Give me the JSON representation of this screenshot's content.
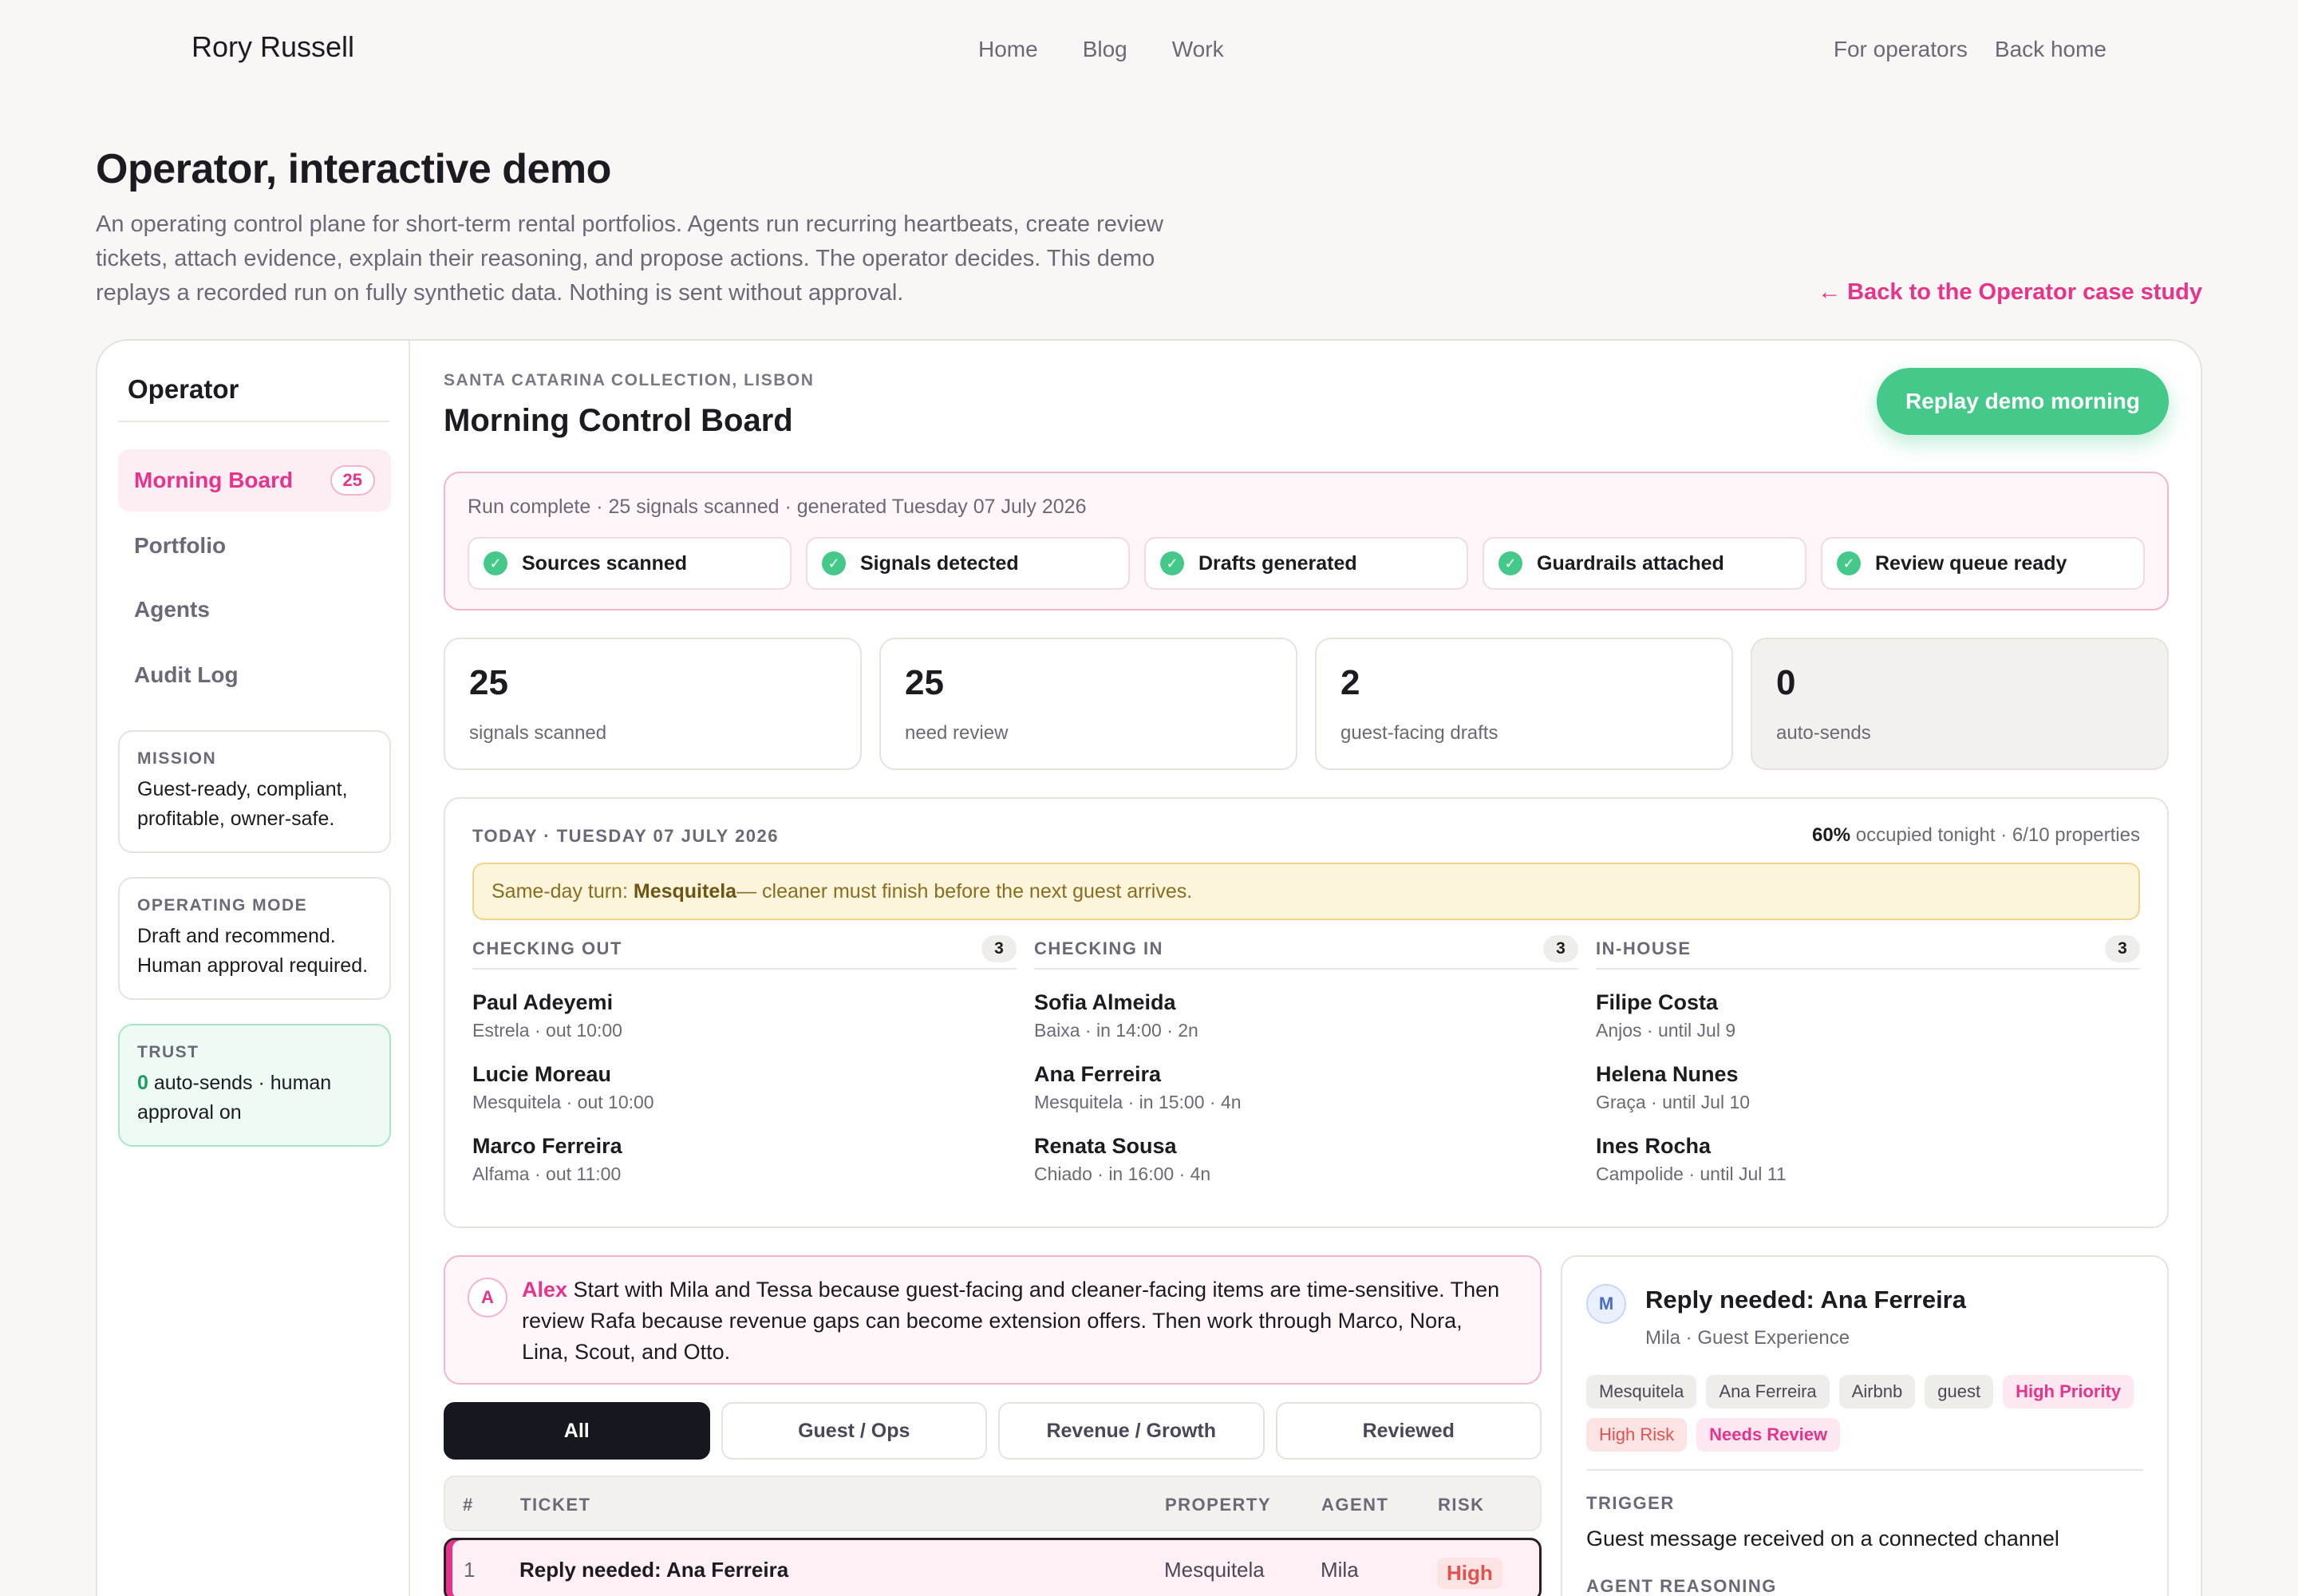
{
  "nav": {
    "brand": "Rory Russell",
    "links": [
      "Home",
      "Blog",
      "Work"
    ],
    "right_links": [
      "For operators",
      "Back home"
    ]
  },
  "hero": {
    "title": "Operator, interactive demo",
    "description": "An operating control plane for short-term rental portfolios. Agents run recurring heartbeats, create review tickets, attach evidence, explain their reasoning, and propose actions. The operator decides. This demo replays a recorded run on fully synthetic data. Nothing is sent without approval.",
    "back_link": "← Back to the Operator case study"
  },
  "sidebar": {
    "title": "Operator",
    "items": [
      {
        "label": "Morning Board",
        "badge": "25",
        "active": true
      },
      {
        "label": "Portfolio"
      },
      {
        "label": "Agents"
      },
      {
        "label": "Audit Log"
      }
    ],
    "mission": {
      "key": "MISSION",
      "value": "Guest-ready, compliant, profitable, owner-safe."
    },
    "mode": {
      "key": "OPERATING MODE",
      "value": "Draft and recommend. Human approval required."
    },
    "trust": {
      "key": "TRUST",
      "count": "0",
      "value": " auto-sends · human approval on"
    }
  },
  "main": {
    "eyebrow": "SANTA CATARINA COLLECTION, LISBON",
    "title": "Morning Control Board",
    "replay_label": "Replay demo morning",
    "run_status": "Run complete · 25 signals scanned · generated Tuesday 07 July 2026",
    "steps": [
      "Sources scanned",
      "Signals detected",
      "Drafts generated",
      "Guardrails attached",
      "Review queue ready"
    ],
    "stats": [
      {
        "num": "25",
        "label": "signals scanned"
      },
      {
        "num": "25",
        "label": "need review"
      },
      {
        "num": "2",
        "label": "guest-facing drafts"
      },
      {
        "num": "0",
        "label": "auto-sends"
      }
    ]
  },
  "today": {
    "date": "TODAY · TUESDAY 07 JULY 2026",
    "occupancy_pct": "60%",
    "occupancy_rest": " occupied tonight · 6/10 properties",
    "alert_prefix": "Same-day turn: ",
    "alert_property": "Mesquitela",
    "alert_rest": " — cleaner must finish before the next guest arrives.",
    "columns": [
      {
        "title": "CHECKING OUT",
        "count": "3",
        "guests": [
          {
            "name": "Paul Adeyemi",
            "detail": "Estrela · out 10:00"
          },
          {
            "name": "Lucie Moreau",
            "detail": "Mesquitela · out 10:00"
          },
          {
            "name": "Marco Ferreira",
            "detail": "Alfama · out 11:00"
          }
        ]
      },
      {
        "title": "CHECKING IN",
        "count": "3",
        "guests": [
          {
            "name": "Sofia Almeida",
            "detail": "Baixa · in 14:00 · 2n"
          },
          {
            "name": "Ana Ferreira",
            "detail": "Mesquitela · in 15:00 · 4n"
          },
          {
            "name": "Renata Sousa",
            "detail": "Chiado · in 16:00 · 4n"
          }
        ]
      },
      {
        "title": "IN-HOUSE",
        "count": "3",
        "guests": [
          {
            "name": "Filipe Costa",
            "detail": "Anjos · until Jul 9"
          },
          {
            "name": "Helena Nunes",
            "detail": "Graça · until Jul 10"
          },
          {
            "name": "Ines Rocha",
            "detail": "Campolide · until Jul 11"
          }
        ]
      }
    ]
  },
  "note": {
    "avatar": "A",
    "author": "Alex",
    "text": " Start with Mila and Tessa because guest-facing and cleaner-facing items are time-sensitive. Then review Rafa because revenue gaps can become extension offers. Then work through Marco, Nora, Lina, Scout, and Otto."
  },
  "filters": [
    "All",
    "Guest / Ops",
    "Revenue / Growth",
    "Reviewed"
  ],
  "table": {
    "headers": {
      "num": "#",
      "ticket": "TICKET",
      "property": "PROPERTY",
      "agent": "AGENT",
      "risk": "RISK"
    },
    "rows": [
      {
        "num": "1",
        "ticket": "Reply needed: Ana Ferreira",
        "property": "Mesquitela",
        "agent": "Mila",
        "risk": "High"
      }
    ]
  },
  "detail": {
    "avatar": "M",
    "title": "Reply needed: Ana Ferreira",
    "subtitle": "Mila · Guest Experience",
    "chips": [
      "Mesquitela",
      "Ana Ferreira",
      "Airbnb",
      "guest",
      "High Priority",
      "High Risk",
      "Needs Review"
    ],
    "trigger_key": "TRIGGER",
    "trigger_value": "Guest message received on a connected channel",
    "reasoning_key": "AGENT REASONING"
  },
  "colors": {
    "accent": "#e8338a",
    "success": "#45c98a",
    "dark": "#16181f"
  }
}
